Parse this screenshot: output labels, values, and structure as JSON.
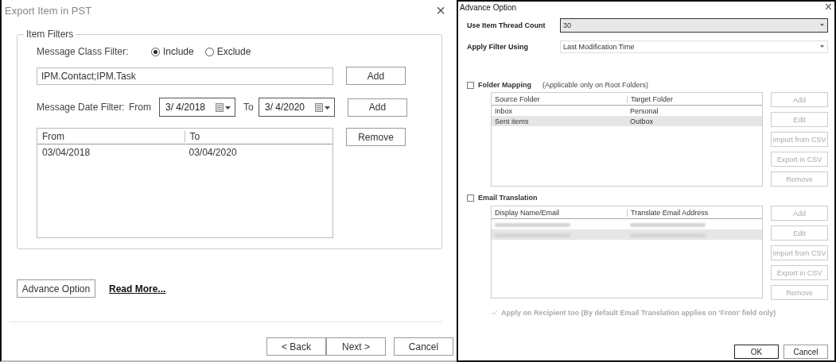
{
  "export_dialog": {
    "title": "Export Item in PST",
    "close": "×",
    "group_title": "Item Filters",
    "class_filter": {
      "label": "Message Class Filter:",
      "options": [
        {
          "label": "Include",
          "selected": true
        },
        {
          "label": "Exclude",
          "selected": false
        }
      ],
      "value": "IPM.Contact;IPM.Task",
      "add": "Add"
    },
    "date_filter": {
      "label": "Message Date Filter:",
      "from_label": "From",
      "from": "3/  4/2018",
      "to_label": "To",
      "to": "3/  4/2020",
      "add": "Add"
    },
    "date_list": {
      "columns": [
        "From",
        "To"
      ],
      "rows": [
        [
          "03/04/2018",
          "03/04/2020"
        ]
      ]
    },
    "remove": "Remove",
    "advance_button": "Advance Option",
    "read_more": "Read More...",
    "nav_buttons": [
      "< Back",
      "Next >"
    ],
    "cancel": "Cancel"
  },
  "advance_dialog": {
    "title": "Advance Option",
    "close": "×",
    "thread_count": {
      "label": "Use Item Thread Count",
      "value": "30"
    },
    "apply_filter": {
      "label": "Apply Filter Using",
      "value": "Last Modification Time"
    },
    "folder_mapping": {
      "label": "Folder Mapping",
      "note": "(Applicable only on Root Folders)",
      "checked": false,
      "columns": [
        "Source Folder",
        "Target Folder"
      ],
      "rows": [
        {
          "cells": [
            "Inbox",
            "Personal"
          ],
          "selected": false
        },
        {
          "cells": [
            "Sent items",
            "Outbox"
          ],
          "selected": true
        }
      ],
      "buttons": [
        "Add",
        "Edit",
        "Import from CSV",
        "Export in CSV",
        "Remove"
      ]
    },
    "email_translation": {
      "label": "Email Translation",
      "checked": false,
      "columns": [
        "Display Name/Email",
        "Translate Email Address"
      ],
      "rows": [
        {
          "selected": false
        },
        {
          "selected": true
        }
      ],
      "buttons": [
        "Add",
        "Edit",
        "Import from CSV",
        "Export in CSV",
        "Remove"
      ]
    },
    "apply_recipient": {
      "label": "Apply on Recipient too (By default Email Translation applies on 'From' field only)",
      "checked": true,
      "disabled": true
    },
    "ok": "OK",
    "cancel": "Cancel"
  }
}
